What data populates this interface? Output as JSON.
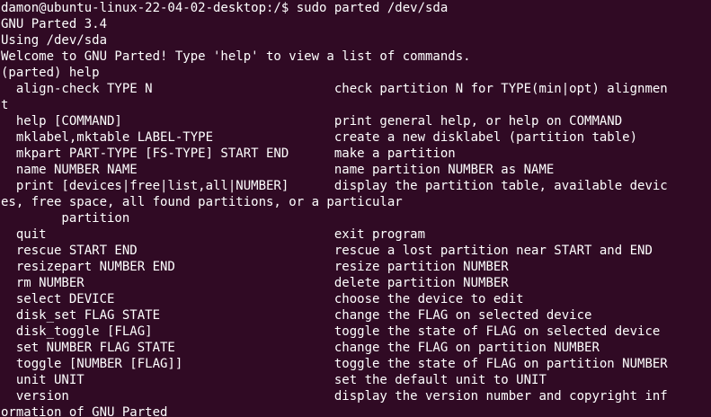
{
  "colors": {
    "background": "#300a24",
    "foreground": "#ffffff"
  },
  "terminal": {
    "lines": [
      "damon@ubuntu-linux-22-04-02-desktop:/$ sudo parted /dev/sda",
      "GNU Parted 3.4",
      "Using /dev/sda",
      "Welcome to GNU Parted! Type 'help' to view a list of commands.",
      "(parted) help",
      "  align-check TYPE N                        check partition N for TYPE(min|opt) alignmen",
      "t",
      "  help [COMMAND]                            print general help, or help on COMMAND",
      "  mklabel,mktable LABEL-TYPE                create a new disklabel (partition table)",
      "  mkpart PART-TYPE [FS-TYPE] START END      make a partition",
      "  name NUMBER NAME                          name partition NUMBER as NAME",
      "  print [devices|free|list,all|NUMBER]      display the partition table, available devic",
      "es, free space, all found partitions, or a particular",
      "        partition",
      "  quit                                      exit program",
      "  rescue START END                          rescue a lost partition near START and END",
      "  resizepart NUMBER END                     resize partition NUMBER",
      "  rm NUMBER                                 delete partition NUMBER",
      "  select DEVICE                             choose the device to edit",
      "  disk_set FLAG STATE                       change the FLAG on selected device",
      "  disk_toggle [FLAG]                        toggle the state of FLAG on selected device",
      "  set NUMBER FLAG STATE                     change the FLAG on partition NUMBER",
      "  toggle [NUMBER [FLAG]]                    toggle the state of FLAG on partition NUMBER",
      "  unit UNIT                                 set the default unit to UNIT",
      "  version                                   display the version number and copyright inf",
      "ormation of GNU Parted"
    ]
  }
}
